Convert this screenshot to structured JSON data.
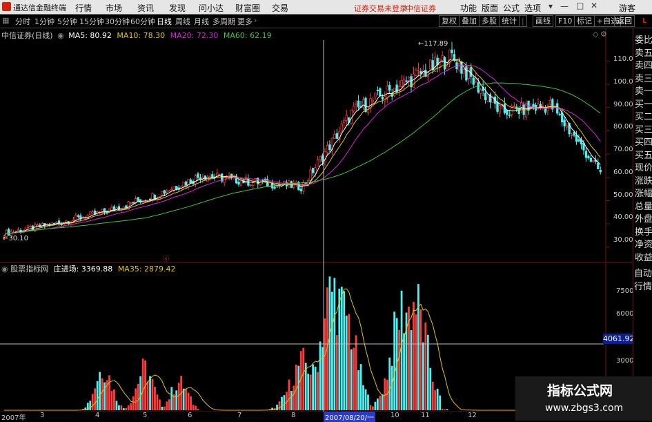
{
  "app": {
    "name": "通达信金融终端"
  },
  "menu": {
    "items": [
      "行情",
      "市场",
      "资讯",
      "发现",
      "问小达",
      "财富圈",
      "交易"
    ],
    "login_warning": "证券交易未登录",
    "broker": "中信证券",
    "right_items": [
      "功能",
      "版面",
      "公式",
      "选项"
    ],
    "guest": "游客"
  },
  "toolbar": {
    "periods": [
      "分时",
      "1分钟",
      "5分钟",
      "15分钟",
      "30分钟",
      "60分钟",
      "日线",
      "周线",
      "月线",
      "多周期",
      "更多"
    ],
    "active": "日线",
    "right_buttons": [
      "复权",
      "叠加",
      "多股",
      "统计",
      "画线",
      "F10",
      "标记",
      "+自选",
      "返回"
    ]
  },
  "main_legend": {
    "title": "中信证券(日线)",
    "ma5": "MA5: 80.92",
    "ma10": "MA10: 78.30",
    "ma20": "MA20: 72.30",
    "ma60": "MA60: 62.19"
  },
  "main_axis": {
    "labels": [
      "110.0",
      "100.0",
      "90.00",
      "80.00",
      "70.00",
      "60.00",
      "50.00",
      "40.00",
      "30.00"
    ]
  },
  "annotations": {
    "high": "117.89",
    "low": "30.10"
  },
  "sub_legend": {
    "title": "股票指标网",
    "line1": "庄进场: 3369.88",
    "line2": "MA35: 2879.42"
  },
  "sub_axis": {
    "labels": [
      "7500",
      "6000",
      "3000"
    ],
    "cursor_value": "4061.92"
  },
  "x_axis": {
    "labels": [
      "2007年",
      "3",
      "4",
      "5",
      "6",
      "7",
      "8",
      "2007/08/20/一",
      "10",
      "11",
      "12"
    ]
  },
  "right_panel": {
    "top_items": [
      "委比",
      "卖五",
      "卖四",
      "卖三",
      "卖一",
      "买一",
      "买二",
      "买三",
      "买四",
      "买五",
      "现价",
      "涨跌",
      "涨幅",
      "总量",
      "外盘",
      "换手",
      "净资",
      "收益"
    ],
    "bottom_items": [
      "自动",
      "行情"
    ],
    "corner": "L"
  },
  "watermark": {
    "line1": "指标公式网",
    "line2": "www.zbgs3.com"
  },
  "colors": {
    "ma5": "#ffffff",
    "ma10": "#e6c800",
    "ma20": "#e020e0",
    "ma60": "#3cc83c",
    "up": "#ff3c3c",
    "down": "#50f0f0",
    "accent": "#d81e06"
  },
  "chart_data": {
    "type": "candlestick",
    "title": "中信证券(日线)",
    "price_range": [
      24,
      122
    ],
    "closes_monthly_estimate": [
      {
        "month": "2007-01",
        "close": 36
      },
      {
        "month": "2007-02",
        "close": 40
      },
      {
        "month": "2007-03",
        "close": 45
      },
      {
        "month": "2007-04",
        "close": 52
      },
      {
        "month": "2007-05",
        "close": 61
      },
      {
        "month": "2007-06",
        "close": 58
      },
      {
        "month": "2007-07",
        "close": 56
      },
      {
        "month": "2007-08",
        "close": 88
      },
      {
        "month": "2007-09",
        "close": 100
      },
      {
        "month": "2007-10",
        "close": 112
      },
      {
        "month": "2007-11",
        "close": 88
      },
      {
        "month": "2007-12",
        "close": 91
      },
      {
        "month": "2008-01",
        "close": 62
      }
    ],
    "indicator": {
      "name": "庄进场",
      "value": 3369.88,
      "ma35": 2879.42,
      "range": [
        0,
        9000
      ]
    }
  }
}
